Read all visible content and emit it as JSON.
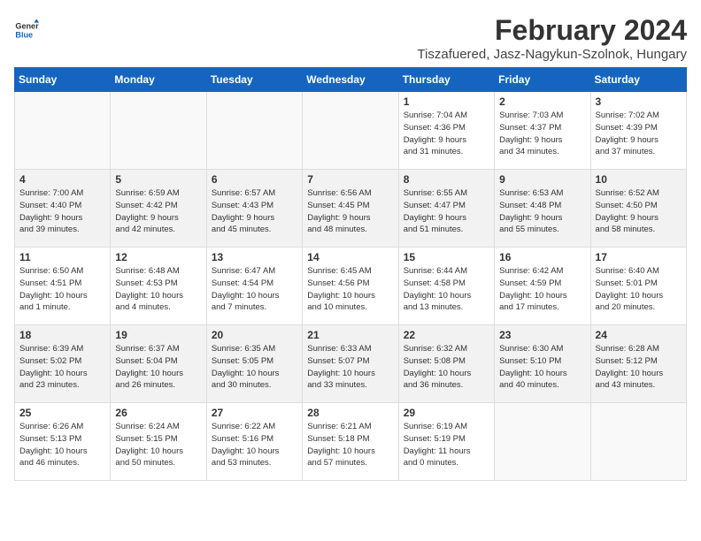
{
  "logo": {
    "line1": "General",
    "line2": "Blue"
  },
  "title": "February 2024",
  "location": "Tiszafuered, Jasz-Nagykun-Szolnok, Hungary",
  "weekdays": [
    "Sunday",
    "Monday",
    "Tuesday",
    "Wednesday",
    "Thursday",
    "Friday",
    "Saturday"
  ],
  "weeks": [
    [
      {
        "day": "",
        "info": ""
      },
      {
        "day": "",
        "info": ""
      },
      {
        "day": "",
        "info": ""
      },
      {
        "day": "",
        "info": ""
      },
      {
        "day": "1",
        "info": "Sunrise: 7:04 AM\nSunset: 4:36 PM\nDaylight: 9 hours\nand 31 minutes."
      },
      {
        "day": "2",
        "info": "Sunrise: 7:03 AM\nSunset: 4:37 PM\nDaylight: 9 hours\nand 34 minutes."
      },
      {
        "day": "3",
        "info": "Sunrise: 7:02 AM\nSunset: 4:39 PM\nDaylight: 9 hours\nand 37 minutes."
      }
    ],
    [
      {
        "day": "4",
        "info": "Sunrise: 7:00 AM\nSunset: 4:40 PM\nDaylight: 9 hours\nand 39 minutes."
      },
      {
        "day": "5",
        "info": "Sunrise: 6:59 AM\nSunset: 4:42 PM\nDaylight: 9 hours\nand 42 minutes."
      },
      {
        "day": "6",
        "info": "Sunrise: 6:57 AM\nSunset: 4:43 PM\nDaylight: 9 hours\nand 45 minutes."
      },
      {
        "day": "7",
        "info": "Sunrise: 6:56 AM\nSunset: 4:45 PM\nDaylight: 9 hours\nand 48 minutes."
      },
      {
        "day": "8",
        "info": "Sunrise: 6:55 AM\nSunset: 4:47 PM\nDaylight: 9 hours\nand 51 minutes."
      },
      {
        "day": "9",
        "info": "Sunrise: 6:53 AM\nSunset: 4:48 PM\nDaylight: 9 hours\nand 55 minutes."
      },
      {
        "day": "10",
        "info": "Sunrise: 6:52 AM\nSunset: 4:50 PM\nDaylight: 9 hours\nand 58 minutes."
      }
    ],
    [
      {
        "day": "11",
        "info": "Sunrise: 6:50 AM\nSunset: 4:51 PM\nDaylight: 10 hours\nand 1 minute."
      },
      {
        "day": "12",
        "info": "Sunrise: 6:48 AM\nSunset: 4:53 PM\nDaylight: 10 hours\nand 4 minutes."
      },
      {
        "day": "13",
        "info": "Sunrise: 6:47 AM\nSunset: 4:54 PM\nDaylight: 10 hours\nand 7 minutes."
      },
      {
        "day": "14",
        "info": "Sunrise: 6:45 AM\nSunset: 4:56 PM\nDaylight: 10 hours\nand 10 minutes."
      },
      {
        "day": "15",
        "info": "Sunrise: 6:44 AM\nSunset: 4:58 PM\nDaylight: 10 hours\nand 13 minutes."
      },
      {
        "day": "16",
        "info": "Sunrise: 6:42 AM\nSunset: 4:59 PM\nDaylight: 10 hours\nand 17 minutes."
      },
      {
        "day": "17",
        "info": "Sunrise: 6:40 AM\nSunset: 5:01 PM\nDaylight: 10 hours\nand 20 minutes."
      }
    ],
    [
      {
        "day": "18",
        "info": "Sunrise: 6:39 AM\nSunset: 5:02 PM\nDaylight: 10 hours\nand 23 minutes."
      },
      {
        "day": "19",
        "info": "Sunrise: 6:37 AM\nSunset: 5:04 PM\nDaylight: 10 hours\nand 26 minutes."
      },
      {
        "day": "20",
        "info": "Sunrise: 6:35 AM\nSunset: 5:05 PM\nDaylight: 10 hours\nand 30 minutes."
      },
      {
        "day": "21",
        "info": "Sunrise: 6:33 AM\nSunset: 5:07 PM\nDaylight: 10 hours\nand 33 minutes."
      },
      {
        "day": "22",
        "info": "Sunrise: 6:32 AM\nSunset: 5:08 PM\nDaylight: 10 hours\nand 36 minutes."
      },
      {
        "day": "23",
        "info": "Sunrise: 6:30 AM\nSunset: 5:10 PM\nDaylight: 10 hours\nand 40 minutes."
      },
      {
        "day": "24",
        "info": "Sunrise: 6:28 AM\nSunset: 5:12 PM\nDaylight: 10 hours\nand 43 minutes."
      }
    ],
    [
      {
        "day": "25",
        "info": "Sunrise: 6:26 AM\nSunset: 5:13 PM\nDaylight: 10 hours\nand 46 minutes."
      },
      {
        "day": "26",
        "info": "Sunrise: 6:24 AM\nSunset: 5:15 PM\nDaylight: 10 hours\nand 50 minutes."
      },
      {
        "day": "27",
        "info": "Sunrise: 6:22 AM\nSunset: 5:16 PM\nDaylight: 10 hours\nand 53 minutes."
      },
      {
        "day": "28",
        "info": "Sunrise: 6:21 AM\nSunset: 5:18 PM\nDaylight: 10 hours\nand 57 minutes."
      },
      {
        "day": "29",
        "info": "Sunrise: 6:19 AM\nSunset: 5:19 PM\nDaylight: 11 hours\nand 0 minutes."
      },
      {
        "day": "",
        "info": ""
      },
      {
        "day": "",
        "info": ""
      }
    ]
  ]
}
